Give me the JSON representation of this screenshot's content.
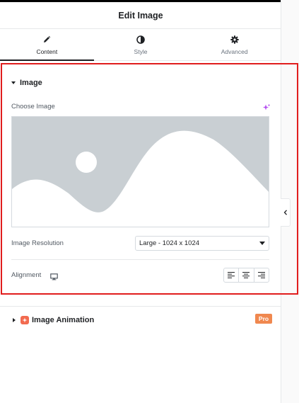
{
  "header": {
    "title": "Edit Image"
  },
  "tabs": [
    {
      "label": "Content",
      "icon": "pencil-icon",
      "active": true
    },
    {
      "label": "Style",
      "icon": "contrast-icon",
      "active": false
    },
    {
      "label": "Advanced",
      "icon": "gear-icon",
      "active": false
    }
  ],
  "image_section": {
    "title": "Image",
    "choose_label": "Choose Image",
    "resolution_label": "Image Resolution",
    "resolution_value": "Large - 1024 x 1024",
    "alignment_label": "Alignment",
    "alignment_options": [
      "align-left-icon",
      "align-center-icon",
      "align-right-icon"
    ]
  },
  "animation_section": {
    "title": "Image Animation",
    "badge": "Pro"
  },
  "colors": {
    "highlight_border": "#e11d1d",
    "ai_accent": "#b44ff0",
    "pro_badge": "#f0884f",
    "placeholder_bg": "#c9cfd3"
  }
}
